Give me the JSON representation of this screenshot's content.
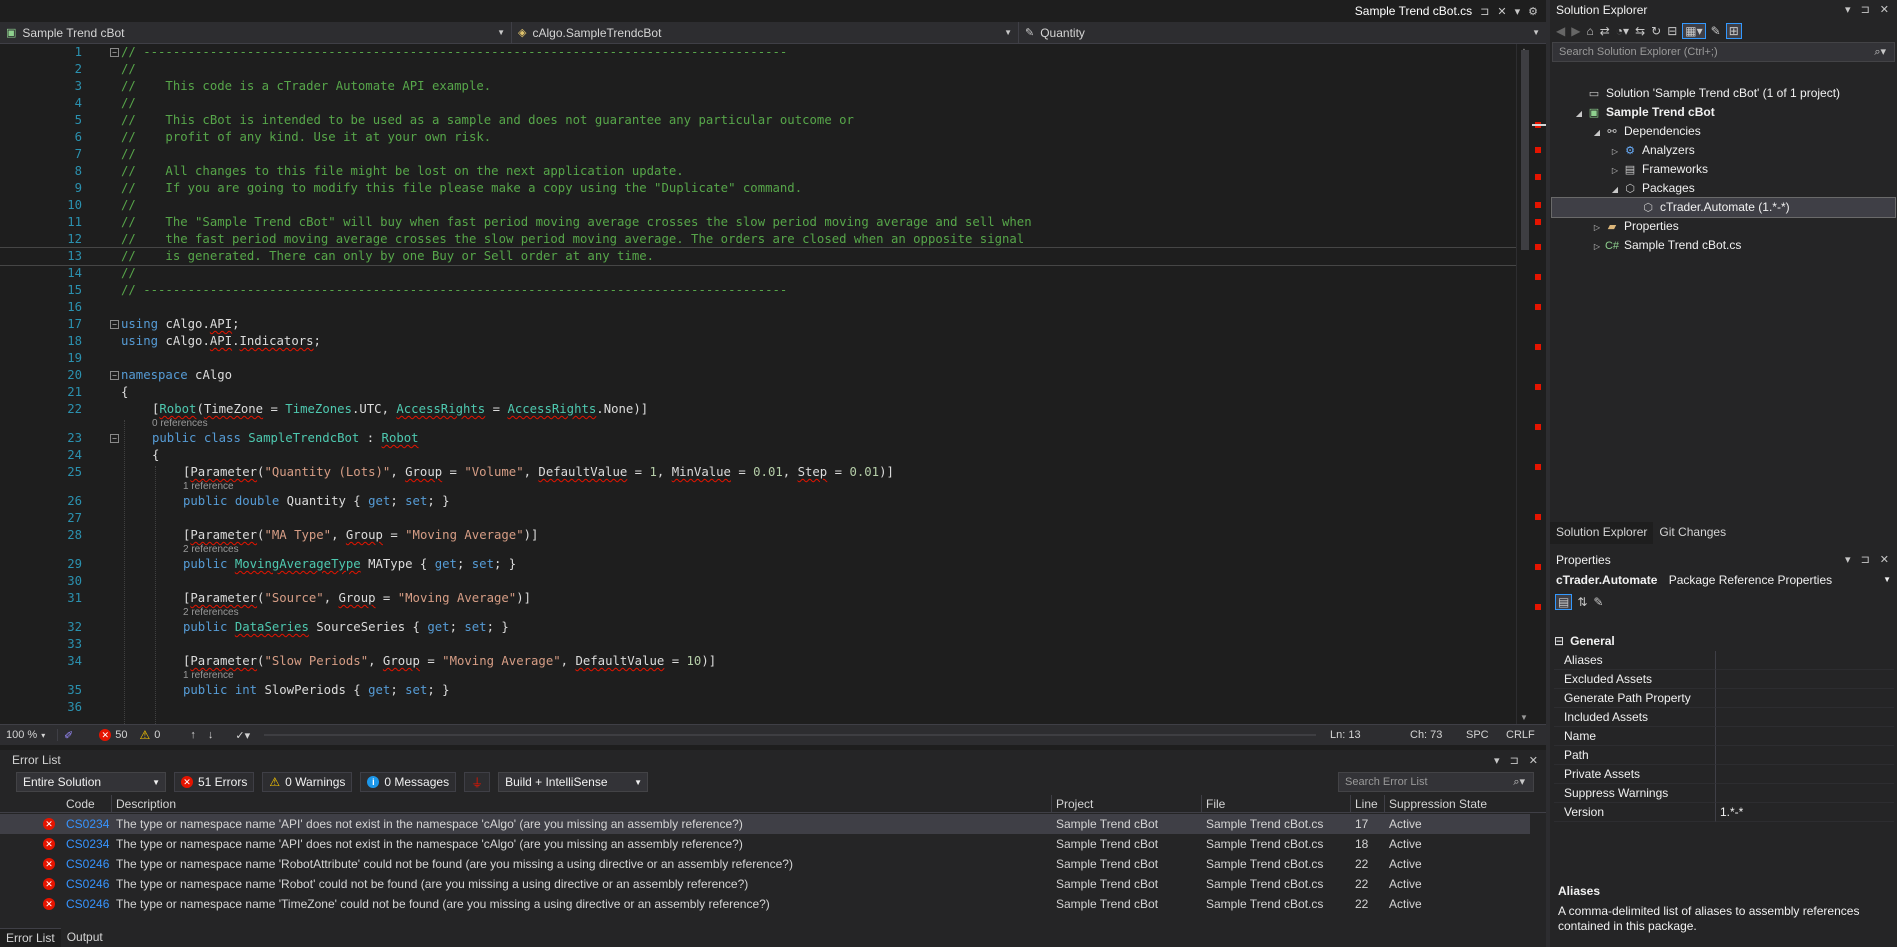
{
  "editor": {
    "doc_tab": {
      "title": "Sample Trend cBot.cs"
    },
    "nav": {
      "project": "Sample Trend cBot",
      "class": "cAlgo.SampleTrendcBot",
      "member": "Quantity"
    },
    "lines": [
      {
        "n": "1",
        "text": "// ---------------------------------------------------------------------------------------"
      },
      {
        "n": "2",
        "text": "//"
      },
      {
        "n": "3",
        "text": "//    This code is a cTrader Automate API example."
      },
      {
        "n": "4",
        "text": "//"
      },
      {
        "n": "5",
        "text": "//    This cBot is intended to be used as a sample and does not guarantee any particular outcome or"
      },
      {
        "n": "6",
        "text": "//    profit of any kind. Use it at your own risk."
      },
      {
        "n": "7",
        "text": "//"
      },
      {
        "n": "8",
        "text": "//    All changes to this file might be lost on the next application update."
      },
      {
        "n": "9",
        "text": "//    If you are going to modify this file please make a copy using the \"Duplicate\" command."
      },
      {
        "n": "10",
        "text": "//"
      },
      {
        "n": "11",
        "text": "//    The \"Sample Trend cBot\" will buy when fast period moving average crosses the slow period moving average and sell when"
      },
      {
        "n": "12",
        "text": "//    the fast period moving average crosses the slow period moving average. The orders are closed when an opposite signal"
      },
      {
        "n": "13",
        "text": "//    is generated. There can only by one Buy or Sell order at any time."
      },
      {
        "n": "14",
        "text": "//"
      },
      {
        "n": "15",
        "text": "// ---------------------------------------------------------------------------------------"
      },
      {
        "n": "16",
        "text": ""
      },
      {
        "n": "17",
        "text": "using cAlgo.API;"
      },
      {
        "n": "18",
        "text": "using cAlgo.API.Indicators;"
      },
      {
        "n": "19",
        "text": ""
      },
      {
        "n": "20",
        "text": "namespace cAlgo"
      },
      {
        "n": "21",
        "text": "{"
      },
      {
        "n": "22",
        "text": "[Robot(TimeZone = TimeZones.UTC, AccessRights = AccessRights.None)]",
        "refs": "0 references"
      },
      {
        "n": "23",
        "text": "public class SampleTrendcBot : Robot"
      },
      {
        "n": "24",
        "text": "{"
      },
      {
        "n": "25",
        "text": "[Parameter(\"Quantity (Lots)\", Group = \"Volume\", DefaultValue = 1, MinValue = 0.01, Step = 0.01)]",
        "refs": "1 reference"
      },
      {
        "n": "26",
        "text": "public double Quantity { get; set; }"
      },
      {
        "n": "27",
        "text": ""
      },
      {
        "n": "28",
        "text": "[Parameter(\"MA Type\", Group = \"Moving Average\")]",
        "refs": "2 references"
      },
      {
        "n": "29",
        "text": "public MovingAverageType MAType { get; set; }"
      },
      {
        "n": "30",
        "text": ""
      },
      {
        "n": "31",
        "text": "[Parameter(\"Source\", Group = \"Moving Average\")]",
        "refs": "2 references"
      },
      {
        "n": "32",
        "text": "public DataSeries SourceSeries { get; set; }"
      },
      {
        "n": "33",
        "text": ""
      },
      {
        "n": "34",
        "text": "[Parameter(\"Slow Periods\", Group = \"Moving Average\", DefaultValue = 10)]",
        "refs": "1 reference"
      },
      {
        "n": "35",
        "text": "public int SlowPeriods { get; set; }"
      },
      {
        "n": "36",
        "text": ""
      }
    ],
    "status": {
      "zoom": "100 %",
      "errors": "50",
      "warnings": "0",
      "line": "Ln: 13",
      "char": "Ch: 73",
      "spc": "SPC",
      "eol": "CRLF"
    }
  },
  "error_list": {
    "title": "Error List",
    "scope": "Entire Solution",
    "errors_label": "51 Errors",
    "warnings_label": "0 Warnings",
    "messages_label": "0 Messages",
    "build_filter": "Build + IntelliSense",
    "search_placeholder": "Search Error List",
    "columns": [
      "Code",
      "Description",
      "Project",
      "File",
      "Line",
      "Suppression State"
    ],
    "rows": [
      {
        "code": "CS0234",
        "desc": "The type or namespace name 'API' does not exist in the namespace 'cAlgo' (are you missing an assembly reference?)",
        "project": "Sample Trend cBot",
        "file": "Sample Trend cBot.cs",
        "line": "17",
        "state": "Active"
      },
      {
        "code": "CS0234",
        "desc": "The type or namespace name 'API' does not exist in the namespace 'cAlgo' (are you missing an assembly reference?)",
        "project": "Sample Trend cBot",
        "file": "Sample Trend cBot.cs",
        "line": "18",
        "state": "Active"
      },
      {
        "code": "CS0246",
        "desc": "The type or namespace name 'RobotAttribute' could not be found (are you missing a using directive or an assembly reference?)",
        "project": "Sample Trend cBot",
        "file": "Sample Trend cBot.cs",
        "line": "22",
        "state": "Active"
      },
      {
        "code": "CS0246",
        "desc": "The type or namespace name 'Robot' could not be found (are you missing a using directive or an assembly reference?)",
        "project": "Sample Trend cBot",
        "file": "Sample Trend cBot.cs",
        "line": "22",
        "state": "Active"
      },
      {
        "code": "CS0246",
        "desc": "The type or namespace name 'TimeZone' could not be found (are you missing a using directive or an assembly reference?)",
        "project": "Sample Trend cBot",
        "file": "Sample Trend cBot.cs",
        "line": "22",
        "state": "Active"
      }
    ],
    "bottom_tabs": [
      "Error List",
      "Output"
    ]
  },
  "solution_explorer": {
    "title": "Solution Explorer",
    "search_placeholder": "Search Solution Explorer (Ctrl+;)",
    "tree": [
      {
        "label": "Solution 'Sample Trend cBot' (1 of 1 project)",
        "icon": "solution-icon"
      },
      {
        "label": "Sample Trend cBot",
        "icon": "project-icon"
      },
      {
        "label": "Dependencies",
        "icon": "dependencies-icon"
      },
      {
        "label": "Analyzers",
        "icon": "analyzer-icon"
      },
      {
        "label": "Frameworks",
        "icon": "framework-icon"
      },
      {
        "label": "Packages",
        "icon": "package-icon"
      },
      {
        "label": "cTrader.Automate (1.*-*)",
        "icon": "package-icon"
      },
      {
        "label": "Properties",
        "icon": "folder-icon"
      },
      {
        "label": "Sample Trend cBot.cs",
        "icon": "csharp-file-icon"
      }
    ],
    "tabs": [
      "Solution Explorer",
      "Git Changes"
    ]
  },
  "properties": {
    "title": "Properties",
    "object_name": "cTrader.Automate",
    "object_type": "Package Reference Properties",
    "category": "General",
    "rows": [
      {
        "key": "Aliases",
        "value": ""
      },
      {
        "key": "Excluded Assets",
        "value": ""
      },
      {
        "key": "Generate Path Property",
        "value": ""
      },
      {
        "key": "Included Assets",
        "value": ""
      },
      {
        "key": "Name",
        "value": ""
      },
      {
        "key": "Path",
        "value": ""
      },
      {
        "key": "Private Assets",
        "value": ""
      },
      {
        "key": "Suppress Warnings",
        "value": ""
      },
      {
        "key": "Version",
        "value": "1.*-*"
      }
    ],
    "desc_title": "Aliases",
    "desc_text": "A comma-delimited list of aliases to assembly references contained in this package."
  }
}
